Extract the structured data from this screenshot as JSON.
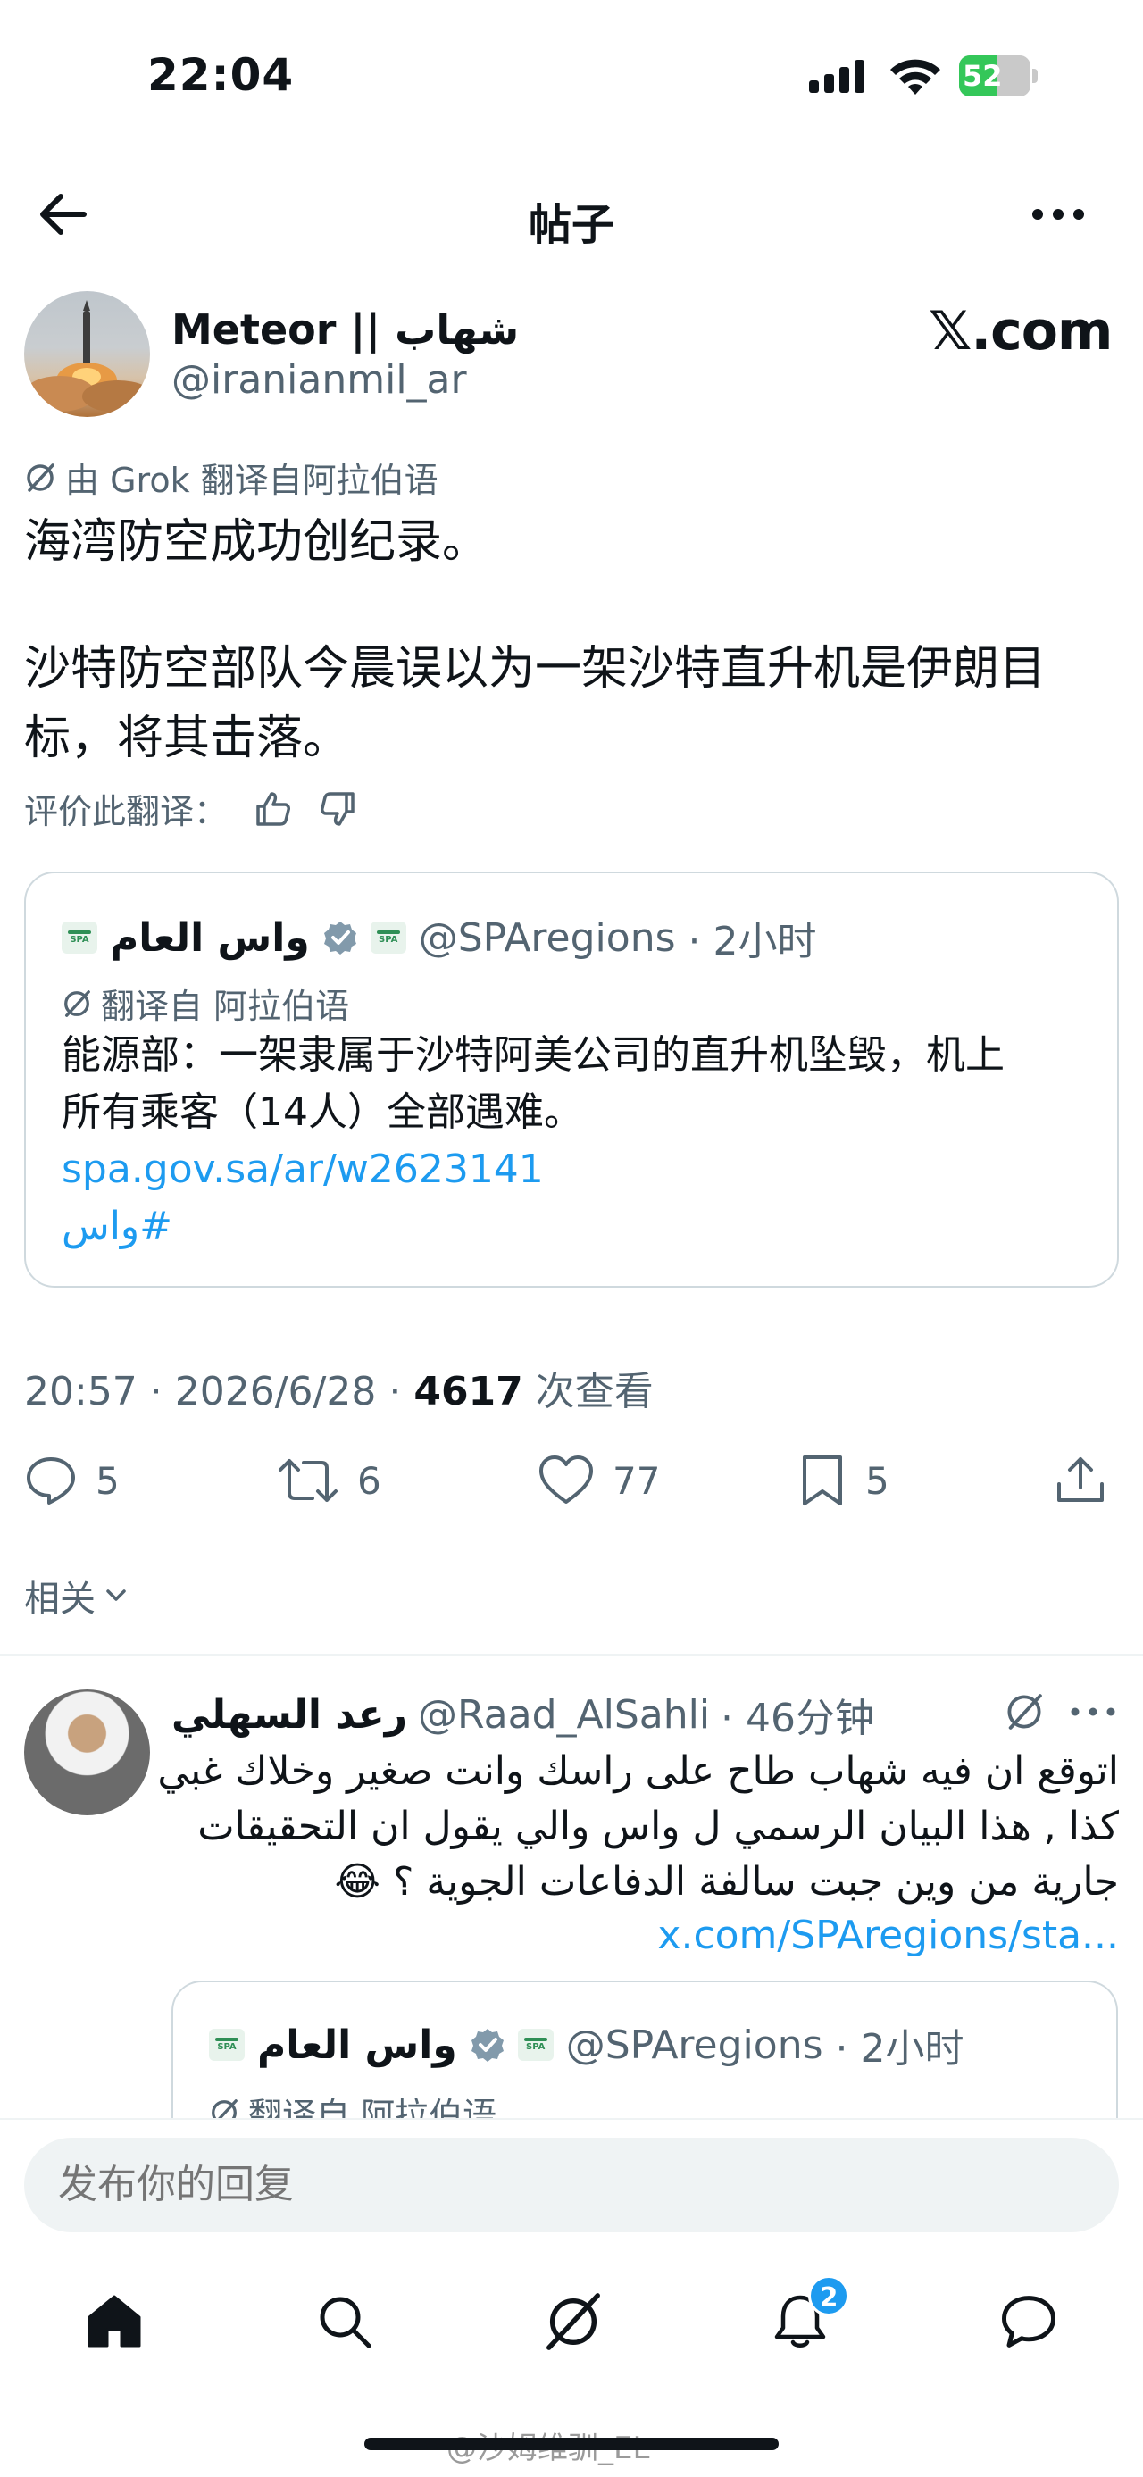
{
  "status_bar": {
    "time": "22:04",
    "battery": "52",
    "battery_level": 0.52
  },
  "header": {
    "title": "帖子"
  },
  "post": {
    "author_name": "Meteor || شهاب",
    "author_handle": "@iranianmil_ar",
    "brand": "𝕏.com",
    "translation_note": "由 Grok 翻译自阿拉伯语",
    "text_line_1": "海湾防空成功创纪录。",
    "text_line_2a": "沙特防空部队今晨误以为一架沙特直升机是伊朗目",
    "text_line_2b": "标，将其击落。",
    "rate_translation": "评价此翻译："
  },
  "quote": {
    "name": "واس العام",
    "handle": "@SPAregions",
    "time": "· 2小时",
    "translation_note": "翻译自 阿拉伯语",
    "text_a": "能源部：一架隶属于沙特阿美公司的直升机坠毁，机上",
    "text_b": "所有乘客（14人）全部遇难。",
    "link": "spa.gov.sa/ar/w2623141",
    "hashtag": "#واس"
  },
  "meta": {
    "time_date": "20:57 · 2026/6/28 · ",
    "views": "4617",
    "views_label": " 次查看"
  },
  "actions": {
    "replies": "5",
    "reposts": "6",
    "likes": "77",
    "bookmarks": "5"
  },
  "related_label": "相关",
  "reply": {
    "name": "رعد السهلي",
    "handle": "@Raad_AlSahli",
    "time": "· 46分钟",
    "line_1": "اتوقع ان فيه شهاب طاح على راسك وانت صغير وخلاك غبي",
    "line_2": "كذا , هذا البيان الرسمي ل واس والي يقول ان التحقيقات",
    "line_3": "جارية من وين جبت سالفة الدفاعات الجوية ؟ 😂",
    "link": "x.com/SPAregions/sta...",
    "quote_name": "واس العام",
    "quote_handle": "@SPAregions",
    "quote_time": "· 2小时",
    "quote_translation_note": "翻译自 阿拉伯语"
  },
  "composer": {
    "placeholder": "发布你的回复"
  },
  "tabbar": {
    "notifications_count": "2"
  },
  "watermark": "@沙姆维驯_EL",
  "colors": {
    "accent": "#1d9bf0",
    "muted": "#536471",
    "border": "#cfd9de"
  }
}
